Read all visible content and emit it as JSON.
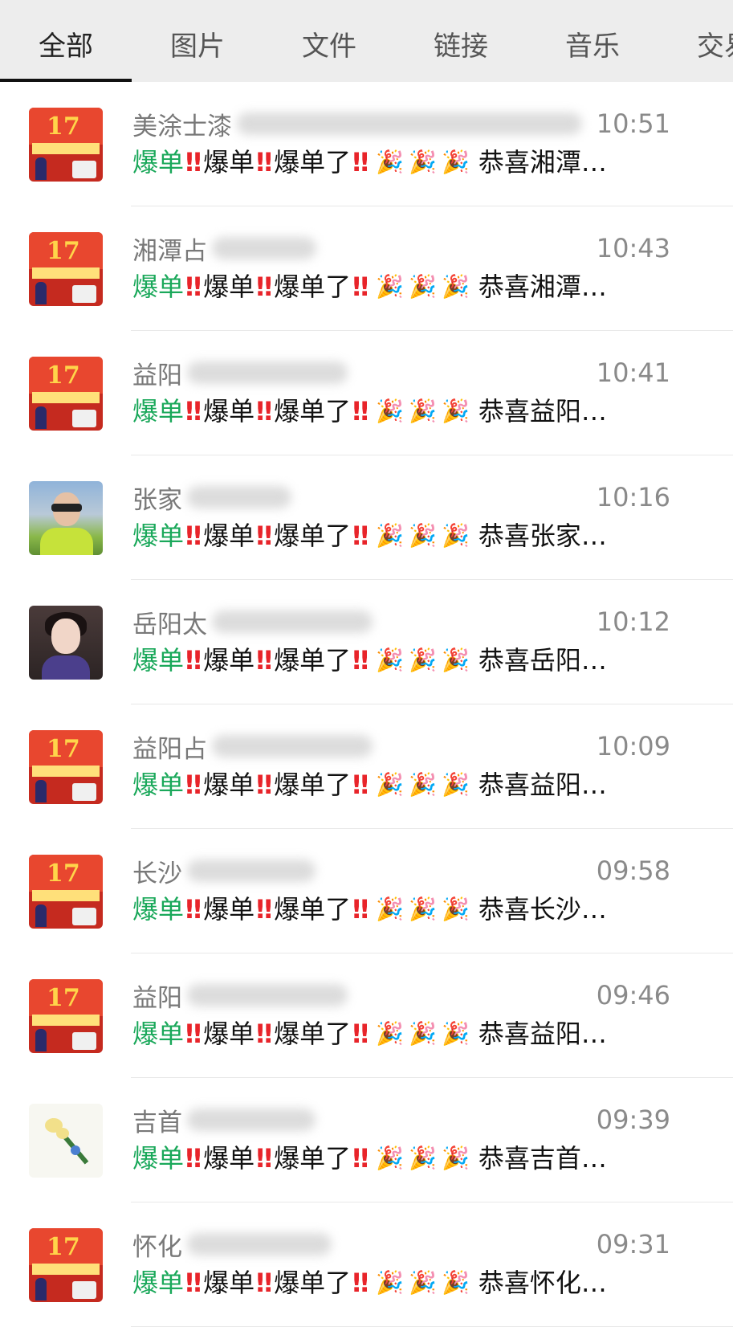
{
  "tabs": [
    "全部",
    "图片",
    "文件",
    "链接",
    "音乐",
    "交易"
  ],
  "message": {
    "w1": "爆单",
    "w2": "爆单",
    "w3": "爆单了",
    "bang": "‼",
    "party": "🎉",
    "prefix": "恭喜"
  },
  "chats": [
    {
      "name": "美涂士漆",
      "time": "10:51",
      "preview_place": "湘潭…",
      "avatar": "poster"
    },
    {
      "name": "湘潭占",
      "time": "10:43",
      "preview_place": "湘潭…",
      "avatar": "poster"
    },
    {
      "name": "益阳",
      "time": "10:41",
      "preview_place": "益阳…",
      "avatar": "poster"
    },
    {
      "name": "张家",
      "time": "10:16",
      "preview_place": "张家…",
      "avatar": "photo1"
    },
    {
      "name": "岳阳太",
      "time": "10:12",
      "preview_place": "岳阳…",
      "avatar": "photo2"
    },
    {
      "name": "益阳占",
      "time": "10:09",
      "preview_place": "益阳…",
      "avatar": "poster"
    },
    {
      "name": "长沙",
      "time": "09:58",
      "preview_place": "长沙…",
      "avatar": "poster"
    },
    {
      "name": "益阳",
      "time": "09:46",
      "preview_place": "益阳…",
      "avatar": "poster"
    },
    {
      "name": "吉首",
      "time": "09:39",
      "preview_place": "吉首…",
      "avatar": "flower"
    },
    {
      "name": "怀化",
      "time": "09:31",
      "preview_place": "怀化…",
      "avatar": "poster"
    }
  ],
  "avatar_text": {
    "poster_num": "17"
  }
}
